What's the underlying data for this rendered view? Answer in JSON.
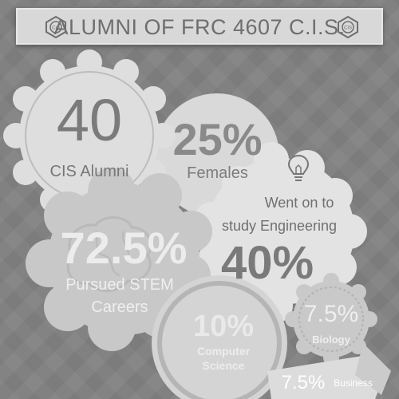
{
  "header": {
    "title": "ALUMNI OF FRC 4607 C.I.S."
  },
  "stats": {
    "alumni": {
      "value": "40",
      "label": "CIS Alumni"
    },
    "females": {
      "value": "25%",
      "label": "Females"
    },
    "engineering": {
      "label_line1": "Went on to",
      "label_line2": "study Engineering",
      "value": "40%"
    },
    "stem": {
      "value": "72.5%",
      "label_line1": "Pursued STEM",
      "label_line2": "Careers"
    },
    "computer_science": {
      "value": "10%",
      "label_line1": "Computer",
      "label_line2": "Science"
    },
    "biology": {
      "value": "7.5%",
      "label": "Biology"
    },
    "business": {
      "value": "7.5%",
      "label": "Business"
    }
  },
  "icons": [
    "cis-badge-icon",
    "lightbulb-icon",
    "brain-icon"
  ],
  "colors": {
    "background": "#7c7c7c",
    "shape_light": "#dcdcdc",
    "shape_mid": "#cfcfcf",
    "text": "#7a7a7a"
  }
}
